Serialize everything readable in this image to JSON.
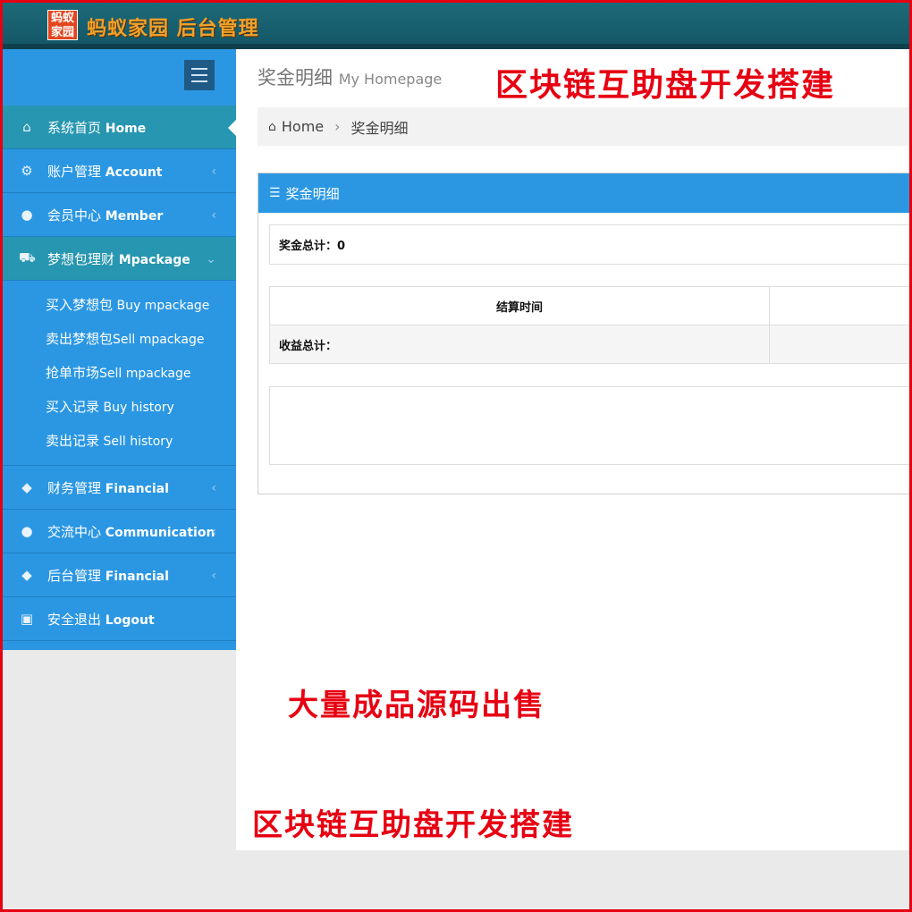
{
  "header": {
    "logo_text_line1": "蚂蚁",
    "logo_text_line2": "家园",
    "brand": "蚂蚁家园 后台管理"
  },
  "sidebar": {
    "items": [
      {
        "label": "系统首页",
        "en": "Home",
        "icon": "home-icon",
        "active": true
      },
      {
        "label": "账户管理",
        "en": "Account",
        "icon": "gear-icon"
      },
      {
        "label": "会员中心",
        "en": "Member",
        "icon": "user-icon"
      },
      {
        "label": "梦想包理财",
        "en": "Mpackage",
        "icon": "cart-icon",
        "open": true
      },
      {
        "label": "财务管理",
        "en": "Financial",
        "icon": "tags-icon"
      },
      {
        "label": "交流中心",
        "en": "Communication",
        "icon": "comments-icon"
      },
      {
        "label": "后台管理",
        "en": "Financial",
        "icon": "tags-icon"
      },
      {
        "label": "安全退出",
        "en": "Logout",
        "icon": "lock-icon"
      }
    ],
    "submenu": [
      {
        "label": "买入梦想包",
        "en": " Buy mpackage"
      },
      {
        "label": "卖出梦想包",
        "en": "Sell mpackage"
      },
      {
        "label": "抢单市场",
        "en": "Sell mpackage"
      },
      {
        "label": "买入记录",
        "en": " Buy history"
      },
      {
        "label": "卖出记录",
        "en": " Sell history"
      }
    ]
  },
  "page": {
    "title": "奖金明细",
    "subtitle": "My Homepage"
  },
  "breadcrumb": {
    "home": "Home",
    "current": "奖金明细"
  },
  "panel": {
    "title": "奖金明细",
    "bonus_total": "奖金总计：0",
    "table_header": "结算时间",
    "income_total": "收益总计："
  },
  "ads": {
    "line1": "区块链互助盘开发搭建",
    "line2": "大量成品源码出售",
    "line3": "区块链互助盘开发搭建",
    "color": "#e60012"
  }
}
